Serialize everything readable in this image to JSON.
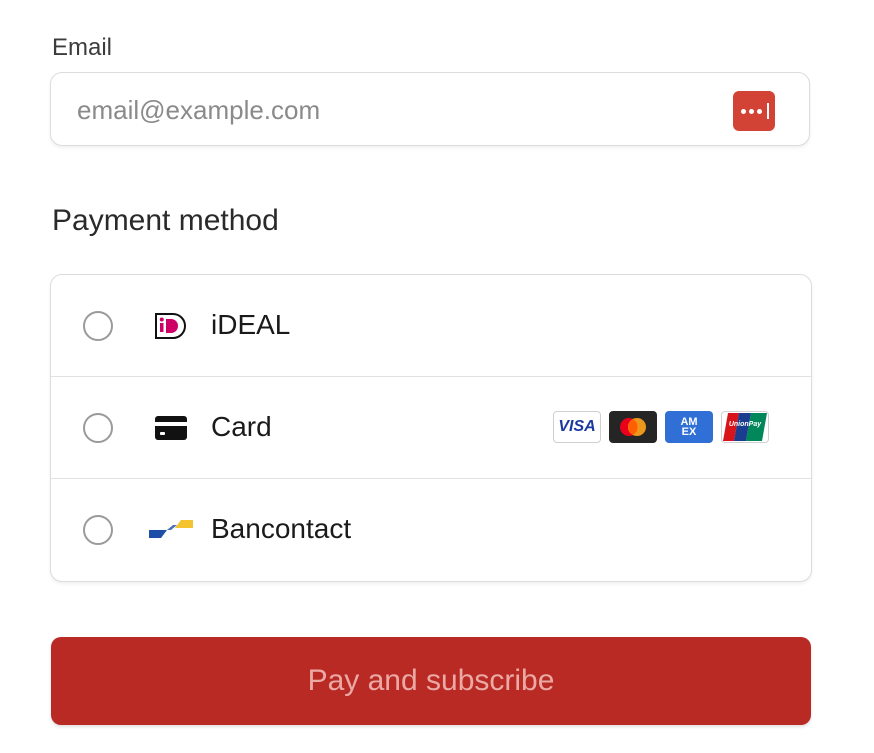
{
  "email": {
    "label": "Email",
    "placeholder": "email@example.com",
    "value": "",
    "autofill_icon": "password-manager-icon"
  },
  "payment": {
    "title": "Payment method",
    "methods": [
      {
        "label": "iDEAL",
        "icon": "ideal-icon",
        "selected": false
      },
      {
        "label": "Card",
        "icon": "credit-card-icon",
        "selected": false,
        "brands": [
          "VISA",
          "Mastercard",
          "AMEX",
          "UnionPay"
        ]
      },
      {
        "label": "Bancontact",
        "icon": "bancontact-icon",
        "selected": false
      }
    ]
  },
  "brand_text": {
    "visa": "VISA",
    "amex_top": "AM",
    "amex_bottom": "EX",
    "unionpay": "UnionPay"
  },
  "submit": {
    "label": "Pay and subscribe"
  },
  "colors": {
    "accent": "#b92a25",
    "button_text": "#eba9a4",
    "autofill_icon_bg": "#d24335",
    "ideal_pink": "#cc0066",
    "bancontact_blue": "#1e4fa8",
    "bancontact_yellow": "#f4c430"
  }
}
